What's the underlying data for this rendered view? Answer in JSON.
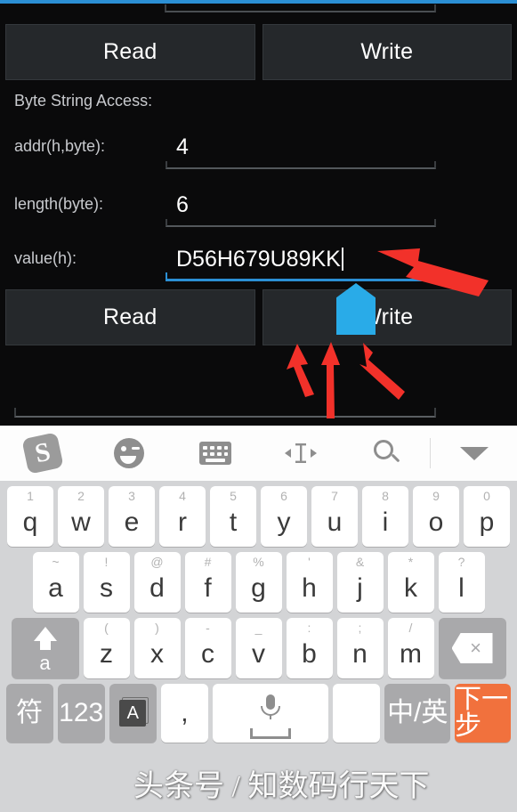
{
  "app": {
    "accent_color": "#2b8fd4",
    "background_color": "#0a0a0b",
    "button_row_top": {
      "read_label": "Read",
      "write_label": "Write"
    },
    "section_label": "Byte String Access:",
    "fields": [
      {
        "label": "addr(h,byte):",
        "value": "4",
        "focused": false
      },
      {
        "label": "length(byte):",
        "value": "6",
        "focused": false
      },
      {
        "label": "value(h):",
        "value": "D56H679U89KK",
        "focused": true
      }
    ],
    "button_row_bottom": {
      "read_label": "Read",
      "write_label": "Write"
    },
    "annotation": {
      "arrow_color": "#f2312a",
      "handle_color": "#29abe8",
      "arrow_count": 4
    }
  },
  "keyboard": {
    "toolbar": [
      {
        "name": "sogou-logo-icon",
        "glyph": "S"
      },
      {
        "name": "emoji-icon",
        "glyph": ""
      },
      {
        "name": "keyboard-icon",
        "glyph": ""
      },
      {
        "name": "cursor-move-icon",
        "glyph": ""
      },
      {
        "name": "search-icon",
        "glyph": ""
      },
      {
        "name": "chevron-down-icon",
        "glyph": ""
      }
    ],
    "rows": {
      "row1": [
        {
          "sup": "1",
          "main": "q"
        },
        {
          "sup": "2",
          "main": "w"
        },
        {
          "sup": "3",
          "main": "e"
        },
        {
          "sup": "4",
          "main": "r"
        },
        {
          "sup": "5",
          "main": "t"
        },
        {
          "sup": "6",
          "main": "y"
        },
        {
          "sup": "7",
          "main": "u"
        },
        {
          "sup": "8",
          "main": "i"
        },
        {
          "sup": "9",
          "main": "o"
        },
        {
          "sup": "0",
          "main": "p"
        }
      ],
      "row2": [
        {
          "sup": "~",
          "main": "a"
        },
        {
          "sup": "!",
          "main": "s"
        },
        {
          "sup": "@",
          "main": "d"
        },
        {
          "sup": "#",
          "main": "f"
        },
        {
          "sup": "%",
          "main": "g"
        },
        {
          "sup": "'",
          "main": "h"
        },
        {
          "sup": "&",
          "main": "j"
        },
        {
          "sup": "*",
          "main": "k"
        },
        {
          "sup": "?",
          "main": "l"
        }
      ],
      "row3": [
        {
          "sup": "(",
          "main": "z"
        },
        {
          "sup": ")",
          "main": "x"
        },
        {
          "sup": "-",
          "main": "c"
        },
        {
          "sup": "_",
          "main": "v"
        },
        {
          "sup": ":",
          "main": "b"
        },
        {
          "sup": ";",
          "main": "n"
        },
        {
          "sup": "/",
          "main": "m"
        }
      ],
      "row3_shift_label": "a",
      "row3_backspace_glyph": "×",
      "row4": {
        "symbol_label": "符",
        "numeric_label": "123",
        "input_mode_label": "A",
        "comma_label": ",",
        "space_label": "",
        "blank_label": "",
        "lang_toggle_label": "中/英",
        "enter_label": "下一步"
      }
    },
    "watermark": "头条号 / 知数码行天下"
  }
}
